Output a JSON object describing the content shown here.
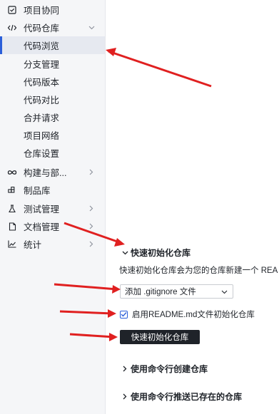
{
  "sidebar": {
    "items": [
      {
        "label": "项目协同",
        "icon": "checkbox-square-icon"
      },
      {
        "label": "代码仓库",
        "icon": "code-brackets-icon",
        "expanded": true
      },
      {
        "label": "代码浏览",
        "active": true
      },
      {
        "label": "分支管理"
      },
      {
        "label": "代码版本"
      },
      {
        "label": "代码对比"
      },
      {
        "label": "合并请求"
      },
      {
        "label": "项目网络"
      },
      {
        "label": "仓库设置"
      },
      {
        "label": "构建与部...",
        "icon": "infinity-icon"
      },
      {
        "label": "制品库",
        "icon": "package-icon"
      },
      {
        "label": "测试管理",
        "icon": "flask-icon"
      },
      {
        "label": "文档管理",
        "icon": "document-icon"
      },
      {
        "label": "统计",
        "icon": "line-chart-icon"
      }
    ]
  },
  "main": {
    "quick_init": {
      "title": "快速初始化仓库",
      "description": "快速初始化仓库会为您的仓库新建一个 REA",
      "gitignore_select": "添加 .gitignore 文件",
      "readme_checkbox_label": "启用README.md文件初始化仓库",
      "readme_checked": true,
      "button_label": "快速初始化仓库"
    },
    "cmd_create": {
      "title": "使用命令行创建仓库"
    },
    "cmd_push": {
      "title": "使用命令行推送已存在的仓库"
    }
  },
  "colors": {
    "accent": "#2b5fd9",
    "sidebar_bg": "#f5f6f8",
    "active_bg": "#e6e9f0",
    "button_bg": "#1f2329",
    "annotation_arrow": "#e02020"
  }
}
